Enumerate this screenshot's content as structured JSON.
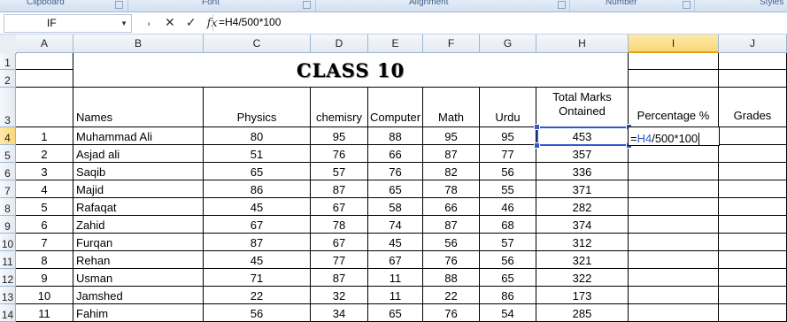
{
  "ribbon": {
    "groups": [
      "Clipboard",
      "Font",
      "Alignment",
      "Number",
      "Styles"
    ]
  },
  "formula_bar": {
    "name_box": "IF",
    "formula": "=H4/500*100",
    "cancel_icon": "✕",
    "enter_icon": "✓",
    "fx_label": "fx"
  },
  "sheet": {
    "columns": [
      "A",
      "B",
      "C",
      "D",
      "E",
      "F",
      "G",
      "H",
      "I",
      "J"
    ],
    "active_column": "I",
    "active_row": "4",
    "row_numbers": [
      "1",
      "2",
      "3",
      "4",
      "5",
      "6",
      "7",
      "8",
      "9",
      "10",
      "11",
      "12",
      "13",
      "14"
    ],
    "title": "CLASS 10",
    "headers": {
      "names": "Names",
      "physics": "Physics",
      "chemistry": "chemisry",
      "computer": "Computer",
      "math": "Math",
      "urdu": "Urdu",
      "total": "Total Marks Ontained",
      "percentage": "Percentage %",
      "grades": "Grades"
    },
    "editing_cell": {
      "prefix": "=",
      "ref": "H4",
      "suffix": "/500*100"
    },
    "students": [
      {
        "no": "1",
        "name": "Muhammad Ali",
        "physics": "80",
        "chemistry": "95",
        "computer": "88",
        "math": "95",
        "urdu": "95",
        "total": "453"
      },
      {
        "no": "2",
        "name": "Asjad ali",
        "physics": "51",
        "chemistry": "76",
        "computer": "66",
        "math": "87",
        "urdu": "77",
        "total": "357"
      },
      {
        "no": "3",
        "name": "Saqib",
        "physics": "65",
        "chemistry": "57",
        "computer": "76",
        "math": "82",
        "urdu": "56",
        "total": "336"
      },
      {
        "no": "4",
        "name": "Majid",
        "physics": "86",
        "chemistry": "87",
        "computer": "65",
        "math": "78",
        "urdu": "55",
        "total": "371"
      },
      {
        "no": "5",
        "name": "Rafaqat",
        "physics": "45",
        "chemistry": "67",
        "computer": "58",
        "math": "66",
        "urdu": "46",
        "total": "282"
      },
      {
        "no": "6",
        "name": "Zahid",
        "physics": "67",
        "chemistry": "78",
        "computer": "74",
        "math": "87",
        "urdu": "68",
        "total": "374"
      },
      {
        "no": "7",
        "name": "Furqan",
        "physics": "87",
        "chemistry": "67",
        "computer": "45",
        "math": "56",
        "urdu": "57",
        "total": "312"
      },
      {
        "no": "8",
        "name": "Rehan",
        "physics": "45",
        "chemistry": "77",
        "computer": "67",
        "math": "76",
        "urdu": "56",
        "total": "321"
      },
      {
        "no": "9",
        "name": "Usman",
        "physics": "71",
        "chemistry": "87",
        "computer": "11",
        "math": "88",
        "urdu": "65",
        "total": "322"
      },
      {
        "no": "10",
        "name": "Jamshed",
        "physics": "22",
        "chemistry": "32",
        "computer": "11",
        "math": "22",
        "urdu": "86",
        "total": "173"
      },
      {
        "no": "11",
        "name": "Fahim",
        "physics": "56",
        "chemistry": "34",
        "computer": "65",
        "math": "76",
        "urdu": "54",
        "total": "285"
      }
    ]
  }
}
